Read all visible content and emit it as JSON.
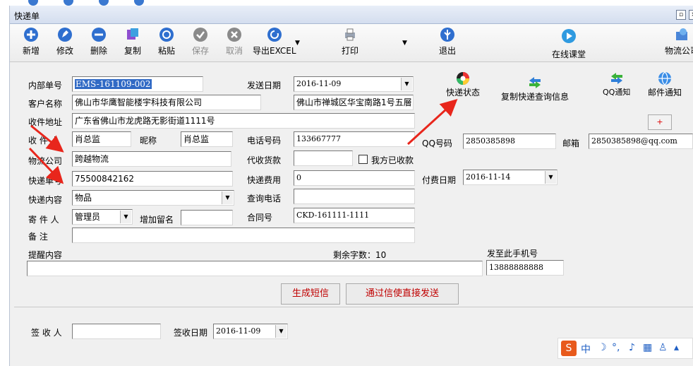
{
  "window": {
    "title": "快递单"
  },
  "toolbar": {
    "new": "新增",
    "edit": "修改",
    "delete": "删除",
    "copy": "复制",
    "paste": "粘贴",
    "save": "保存",
    "cancel": "取消",
    "export": "导出EXCEL",
    "print": "打印",
    "exit": "退出",
    "online": "在线课堂",
    "logistics": "物流公司"
  },
  "labels": {
    "internal_no": "内部单号",
    "customer": "客户名称",
    "recv_addr": "收件地址",
    "receiver": "收 件 人",
    "nickname": "昵称",
    "logistics_co": "物流公司",
    "tracking_no": "快递单号",
    "content": "快递内容",
    "sender": "寄 件 人",
    "note": "备    注",
    "reminder": "提醒内容",
    "send_date": "发送日期",
    "phone": "电话号码",
    "cod": "代收货款",
    "paid": "我方已收款",
    "fee": "快递费用",
    "query_phone": "查询电话",
    "contract": "合同号",
    "remaining": "剩余字数：10",
    "send_to_phone": "发至此手机号",
    "qq": "QQ号码",
    "email": "邮箱",
    "pay_date": "付费日期",
    "add_note": "增加留名",
    "signer": "签 收 人",
    "sign_date": "签收日期"
  },
  "values": {
    "internal_no": "EMS-161109-002",
    "customer": "佛山市华鹰智能楼宇科技有限公司",
    "customer_addr": "佛山市禅城区华宝南路1号五層",
    "recv_addr": "广东省佛山市龙虎路无影街道1111号",
    "receiver": "肖总监",
    "nickname": "肖总监",
    "logistics_co": "跨越物流",
    "tracking_no": "75500842162",
    "content": "物品",
    "sender": "管理员",
    "add_note": "",
    "note": "",
    "reminder": "",
    "send_date": "2016-11-09",
    "phone": "133667777",
    "cod": "",
    "fee": "0",
    "query_phone": "",
    "contract": "CKD-161111-1111",
    "qq": "2850385898",
    "email": "2850385898@qq.com",
    "pay_date": "2016-11-14",
    "mobile": "13888888888",
    "signer": "",
    "sign_date": "2016-11-09"
  },
  "actions": {
    "express_status": "快递状态",
    "copy_query": "复制快递查询信息",
    "qq_notify": "QQ通知",
    "email_notify": "邮件通知",
    "gen_sms": "生成短信",
    "send_sms": "通过信使直接发送",
    "plus": "+"
  },
  "ime": {
    "label": "中"
  }
}
